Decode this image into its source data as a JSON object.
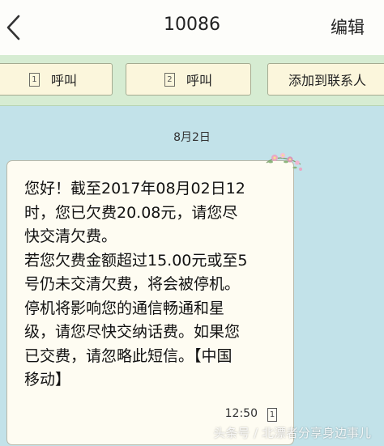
{
  "header": {
    "back_icon": "chevron-left-icon",
    "title": "10086",
    "edit_label": "编辑"
  },
  "actions": {
    "call1": {
      "sim": "1",
      "label": "呼叫"
    },
    "call2": {
      "sim": "2",
      "label": "呼叫"
    },
    "add_contact": {
      "label": "添加到联系人"
    }
  },
  "conversation": {
    "date": "8月2日",
    "message": {
      "lines": [
        "您好！截至2017年08月02日12",
        "时，您已欠费20.08元，请您尽",
        "快交清欠费。",
        "若您欠费金额超过15.00元或至5",
        "号仍未交清欠费，将会被停机。",
        "停机将影响您的通信畅通和星",
        "级，请您尽快交纳话费。如果您",
        "已交费，请忽略此短信。【中国",
        "移动】"
      ],
      "time": "12:50",
      "sim": "1"
    }
  },
  "watermark": "头条号 / 北漂者分享身边事儿",
  "colors": {
    "background": "#c2e2e9",
    "action_bar": "#d6ecd2",
    "button": "#fbf6dc",
    "bubble": "#fefcf2"
  }
}
